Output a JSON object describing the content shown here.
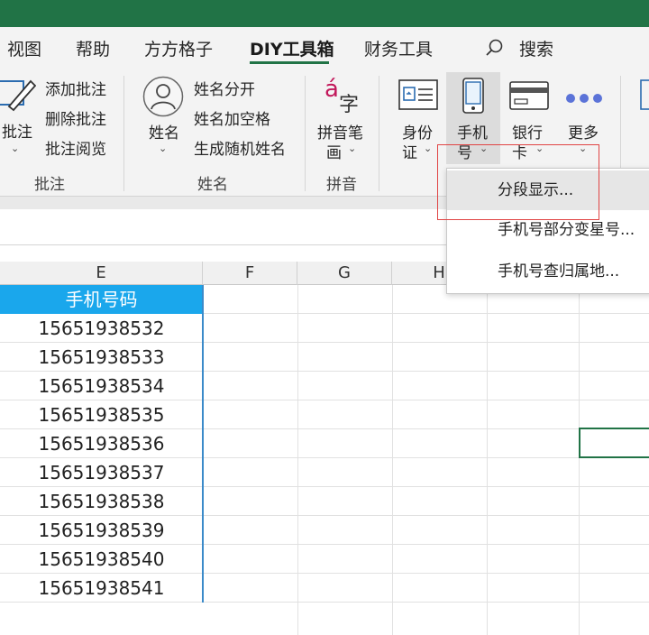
{
  "tabs": [
    "视图",
    "帮助",
    "方方格子",
    "DIY工具箱",
    "财务工具",
    "搜索"
  ],
  "ribbon": {
    "annotation": {
      "big_label": "批注",
      "items": [
        "添加批注",
        "删除批注",
        "批注阅览"
      ],
      "group": "批注"
    },
    "name": {
      "big_label": "姓名",
      "items": [
        "姓名分开",
        "姓名加空格",
        "生成随机姓名"
      ],
      "group": "姓名"
    },
    "pinyin": {
      "icon_text_a": "á",
      "icon_text_b": "字",
      "label_1": "拼音笔",
      "label_2": "画",
      "group": "拼音"
    },
    "id_card": {
      "label_1": "身份",
      "label_2": "证"
    },
    "phone": {
      "label_1": "手机",
      "label_2": "号"
    },
    "bank": {
      "label_1": "银行",
      "label_2": "卡"
    },
    "more": {
      "label_1": "更多"
    }
  },
  "menu": {
    "items": [
      "分段显示...",
      "手机号部分变星号...",
      "手机号查归属地..."
    ]
  },
  "sheet": {
    "columns": [
      "E",
      "F",
      "G",
      "H"
    ],
    "header": "手机号码",
    "phones": [
      "15651938532",
      "15651938533",
      "15651938534",
      "15651938535",
      "15651938536",
      "15651938537",
      "15651938538",
      "15651938539",
      "15651938540",
      "15651938541"
    ]
  },
  "colors": {
    "excel_green": "#217346",
    "header_blue": "#1aa7ec",
    "highlight_red": "#e04444"
  }
}
